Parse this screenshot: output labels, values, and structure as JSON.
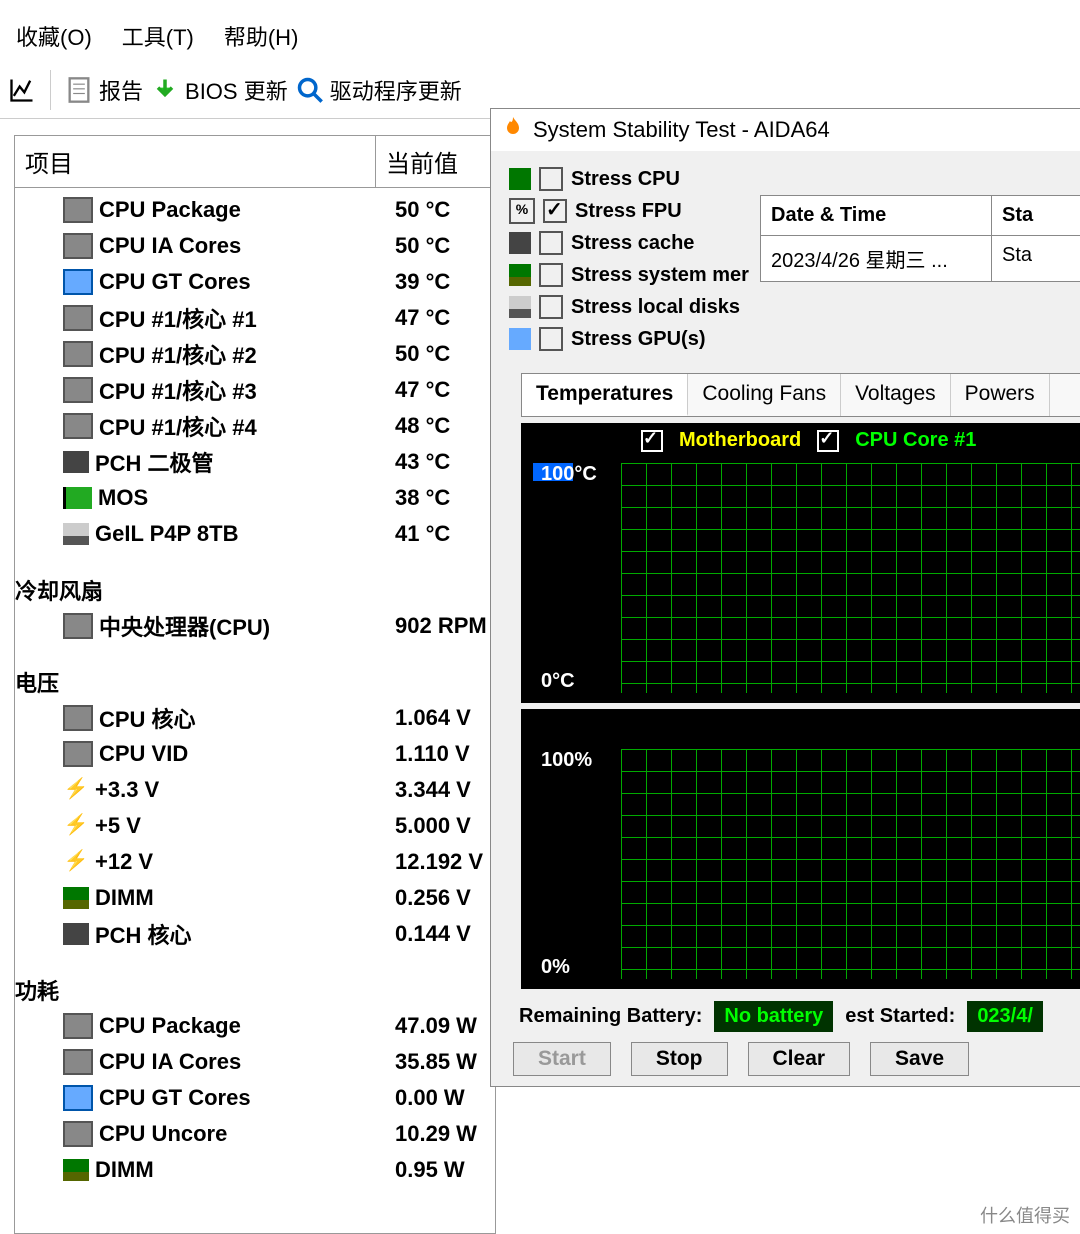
{
  "menu": {
    "fav": "收藏(O)",
    "tools": "工具(T)",
    "help": "帮助(H)"
  },
  "toolbar": {
    "report": "报告",
    "bios": "BIOS 更新",
    "driver": "驱动程序更新"
  },
  "panel": {
    "col1": "项目",
    "col2": "当前值"
  },
  "temps": [
    {
      "icon": "chip",
      "label": "CPU Package",
      "val": "50 °C"
    },
    {
      "icon": "chip",
      "label": "CPU IA Cores",
      "val": "50 °C"
    },
    {
      "icon": "chip-blue",
      "label": "CPU GT Cores",
      "val": "39 °C"
    },
    {
      "icon": "chip",
      "label": "CPU #1/核心 #1",
      "val": "47 °C"
    },
    {
      "icon": "chip",
      "label": "CPU #1/核心 #2",
      "val": "50 °C"
    },
    {
      "icon": "chip",
      "label": "CPU #1/核心 #3",
      "val": "47 °C"
    },
    {
      "icon": "chip",
      "label": "CPU #1/核心 #4",
      "val": "48 °C"
    },
    {
      "icon": "pch",
      "label": "PCH 二极管",
      "val": "43 °C"
    },
    {
      "icon": "batt",
      "label": "MOS",
      "val": "38 °C"
    },
    {
      "icon": "drive",
      "label": "GeIL P4P 8TB",
      "val": "41 °C"
    }
  ],
  "sections": {
    "fan": "冷却风扇",
    "voltage": "电压",
    "power": "功耗"
  },
  "fans": [
    {
      "icon": "chip",
      "label": "中央处理器(CPU)",
      "val": "902 RPM"
    }
  ],
  "voltages": [
    {
      "icon": "chip",
      "label": "CPU 核心",
      "val": "1.064 V"
    },
    {
      "icon": "chip",
      "label": "CPU VID",
      "val": "1.110 V"
    },
    {
      "icon": "bolt",
      "label": "+3.3 V",
      "val": "3.344 V"
    },
    {
      "icon": "bolt",
      "label": "+5 V",
      "val": "5.000 V"
    },
    {
      "icon": "bolt",
      "label": "+12 V",
      "val": "12.192 V"
    },
    {
      "icon": "ram",
      "label": "DIMM",
      "val": "0.256 V"
    },
    {
      "icon": "pch",
      "label": "PCH 核心",
      "val": "0.144 V"
    }
  ],
  "powers": [
    {
      "icon": "chip",
      "label": "CPU Package",
      "val": "47.09 W"
    },
    {
      "icon": "chip",
      "label": "CPU IA Cores",
      "val": "35.85 W"
    },
    {
      "icon": "chip-blue",
      "label": "CPU GT Cores",
      "val": "0.00 W"
    },
    {
      "icon": "chip",
      "label": "CPU Uncore",
      "val": "10.29 W"
    },
    {
      "icon": "ram",
      "label": "DIMM",
      "val": "0.95 W"
    }
  ],
  "sst": {
    "title": "System Stability Test - AIDA64",
    "stress": [
      {
        "icon": "cpu",
        "label": "Stress CPU",
        "checked": false
      },
      {
        "icon": "percent",
        "label": "Stress FPU",
        "checked": true
      },
      {
        "icon": "pch",
        "label": "Stress cache",
        "checked": false
      },
      {
        "icon": "ram",
        "label": "Stress system mer",
        "checked": false
      },
      {
        "icon": "drive",
        "label": "Stress local disks",
        "checked": false
      },
      {
        "icon": "gpu",
        "label": "Stress GPU(s)",
        "checked": false
      }
    ],
    "dt": {
      "h1": "Date & Time",
      "h2": "Sta",
      "d1": "2023/4/26 星期三 ...",
      "d2": "Sta"
    },
    "tabs": [
      "Temperatures",
      "Cooling Fans",
      "Voltages",
      "Powers"
    ],
    "legend": {
      "a": "Motherboard",
      "b": "CPU Core #1"
    },
    "chart1": {
      "top": "100°C",
      "bot": "0°C"
    },
    "chart2": {
      "top": "100%",
      "bot": "0%"
    },
    "battery": {
      "label": "Remaining Battery:",
      "val": "No battery",
      "started": "est Started:",
      "ts": "023/4/"
    },
    "btns": {
      "start": "Start",
      "stop": "Stop",
      "clear": "Clear",
      "save": "Save"
    }
  },
  "watermark": "什么值得买",
  "chart_data": {
    "type": "line",
    "title": "Temperatures",
    "ylabel": "°C",
    "ylim": [
      0,
      100
    ],
    "series": [
      {
        "name": "Motherboard",
        "values": []
      },
      {
        "name": "CPU Core #1",
        "values": []
      }
    ]
  }
}
